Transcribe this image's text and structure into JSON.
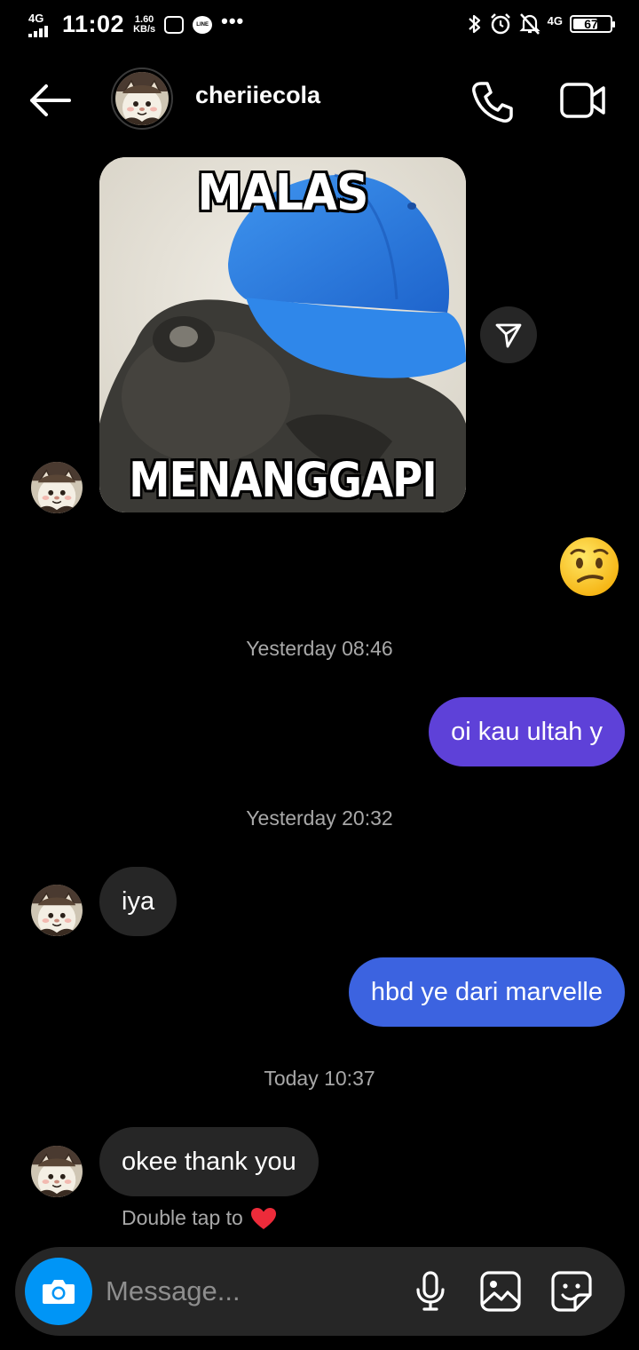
{
  "status_bar": {
    "network_left": "4G",
    "time": "11:02",
    "speed_value": "1.60",
    "speed_unit": "KB/s",
    "line_app": "LINE",
    "more": "•••",
    "network_right": "4G",
    "battery": "67",
    "battery_level": 0.67
  },
  "header": {
    "username": "cheriiecola",
    "icons": [
      "back-arrow-icon",
      "phone-icon",
      "video-camera-icon"
    ]
  },
  "sticker": {
    "top_text": "MALAS",
    "bottom_text": "MENANGGAPI"
  },
  "reaction_emoji": "😕",
  "messages": [
    {
      "type": "timestamp",
      "text": "Yesterday 08:46"
    },
    {
      "type": "outgoing",
      "text": "oi kau ultah y",
      "color": "#5e41d8"
    },
    {
      "type": "timestamp",
      "text": "Yesterday 20:32"
    },
    {
      "type": "incoming",
      "text": "iya"
    },
    {
      "type": "outgoing",
      "text": "hbd ye dari marvelle",
      "color": "#3c63e0"
    },
    {
      "type": "timestamp",
      "text": "Today 10:37"
    },
    {
      "type": "incoming",
      "text": "okee thank you"
    }
  ],
  "double_tap_hint": "Double tap to",
  "composer": {
    "placeholder": "Message...",
    "icons": [
      "camera-icon",
      "microphone-icon",
      "gallery-icon",
      "sticker-icon"
    ]
  },
  "colors": {
    "background": "#000000",
    "incoming_bubble": "#262626",
    "camera_button": "#0095f6",
    "heart": "#ed2b3a"
  }
}
